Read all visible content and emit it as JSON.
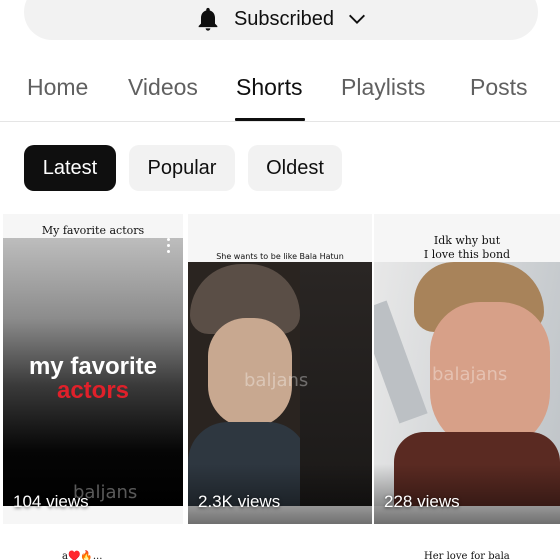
{
  "subscribe": {
    "label": "Subscribed",
    "bell_icon": "bell-icon",
    "chevron_icon": "chevron-down-icon"
  },
  "tabs": [
    {
      "label": "Home",
      "active": false
    },
    {
      "label": "Videos",
      "active": false
    },
    {
      "label": "Shorts",
      "active": true
    },
    {
      "label": "Playlists",
      "active": false
    },
    {
      "label": "Posts",
      "active": false
    }
  ],
  "chips": [
    {
      "label": "Latest",
      "selected": true
    },
    {
      "label": "Popular",
      "selected": false
    },
    {
      "label": "Oldest",
      "selected": false
    }
  ],
  "shorts": [
    {
      "caption": "My favorite actors",
      "overlay_line1": "my favorite",
      "overlay_line2": "actors",
      "watermark": "baljans",
      "views": "104 views"
    },
    {
      "caption": "She wants to be like Bala Hatun",
      "watermark": "baljans",
      "views": "2.3K views"
    },
    {
      "caption_line1": "Idk why but",
      "caption_line2": "I love this bond",
      "watermark": "balajans",
      "views": "228 views"
    }
  ],
  "next_row": {
    "caption_left": "a♥️🔥...",
    "caption_right": "Her love for bala"
  },
  "colors": {
    "text": "#0f0f0f",
    "muted": "#606060",
    "chip_bg": "#f2f2f2",
    "overlay_red": "#e0202a"
  }
}
